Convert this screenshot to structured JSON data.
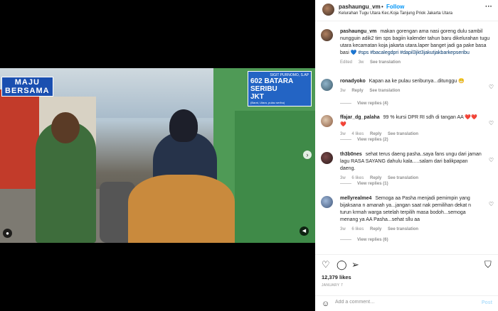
{
  "video": {
    "banner_left_line1": "MAJU",
    "banner_left_line2": "BERSAMA",
    "banner_right_line1": "SIGIT PURNOMO, S.AP",
    "banner_right_line2": "602 BATARA SERIBU",
    "banner_right_line3": "JKT",
    "banner_right_line4": "(Barat, Utara, pulau seribu)"
  },
  "header": {
    "username": "pashaungu_vm",
    "dot": "•",
    "follow_label": "Follow",
    "location": "Kelurahan Tugu Utara Kec.Koja Tanjung Priok Jakarta Utara",
    "more": "···"
  },
  "caption": {
    "username": "pashaungu_vm",
    "text": "makan gorengan ama nasi goreng dulu sambil nungguin adik2 tim sps bagiin kalender tahun baru dikelurahan tugu utara kecamatan koja jakarta utara.laper banget jadi ga pake basa basi",
    "heart": "💙",
    "hashtags": "#sps #bacalegdpri #dapil3jkt3jakutjakbarkepseribu",
    "edited": "Edited",
    "age": "3w",
    "see_translation": "See translation"
  },
  "comments": [
    {
      "username": "ronadyoko",
      "text": "Kapan aa ke pulau seribunya...ditunggu",
      "emoji": "😁",
      "age": "3w",
      "likes": "",
      "reply": "Reply",
      "see_translation": "See translation",
      "view_replies": "View replies (4)"
    },
    {
      "username": "ffajar_dg_palaha",
      "text": "99 % kursi DPR RI sdh di tangan AA",
      "emoji": "❤️❤️❤️",
      "age": "3w",
      "likes": "4 likes",
      "reply": "Reply",
      "see_translation": "See translation",
      "view_replies": "View replies (2)"
    },
    {
      "username": "th3b0nes",
      "text": "sehat terus daeng pasha..saya fans ungu dari jaman lagu RASA SAYANG dahulu kala.....salam dari balikpapan daeng.",
      "emoji": "",
      "age": "3w",
      "likes": "6 likes",
      "reply": "Reply",
      "see_translation": "See translation",
      "view_replies": "View replies (1)"
    },
    {
      "username": "mellyrealme4",
      "text": "Semoga aa Pasha menjadi pemimpin yang bijaksana n amanah ya...jangan saat nak pemilihan dekat n turun krmah warga setelah terpilih masa bodoh...semoga menang ya AA Pasha...sehat sllu aa",
      "emoji": "",
      "age": "3w",
      "likes": "6 likes",
      "reply": "Reply",
      "see_translation": "See translation",
      "view_replies": "View replies (6)"
    }
  ],
  "actions": {
    "like_icon": "heart-outline-icon",
    "comment_icon": "comment-bubble-icon",
    "share_icon": "paper-plane-icon",
    "save_icon": "bookmark-icon"
  },
  "likes": "12,379 likes",
  "date": "JANUARY 7",
  "add_comment": {
    "placeholder": "Add a comment…",
    "post_label": "Post"
  }
}
